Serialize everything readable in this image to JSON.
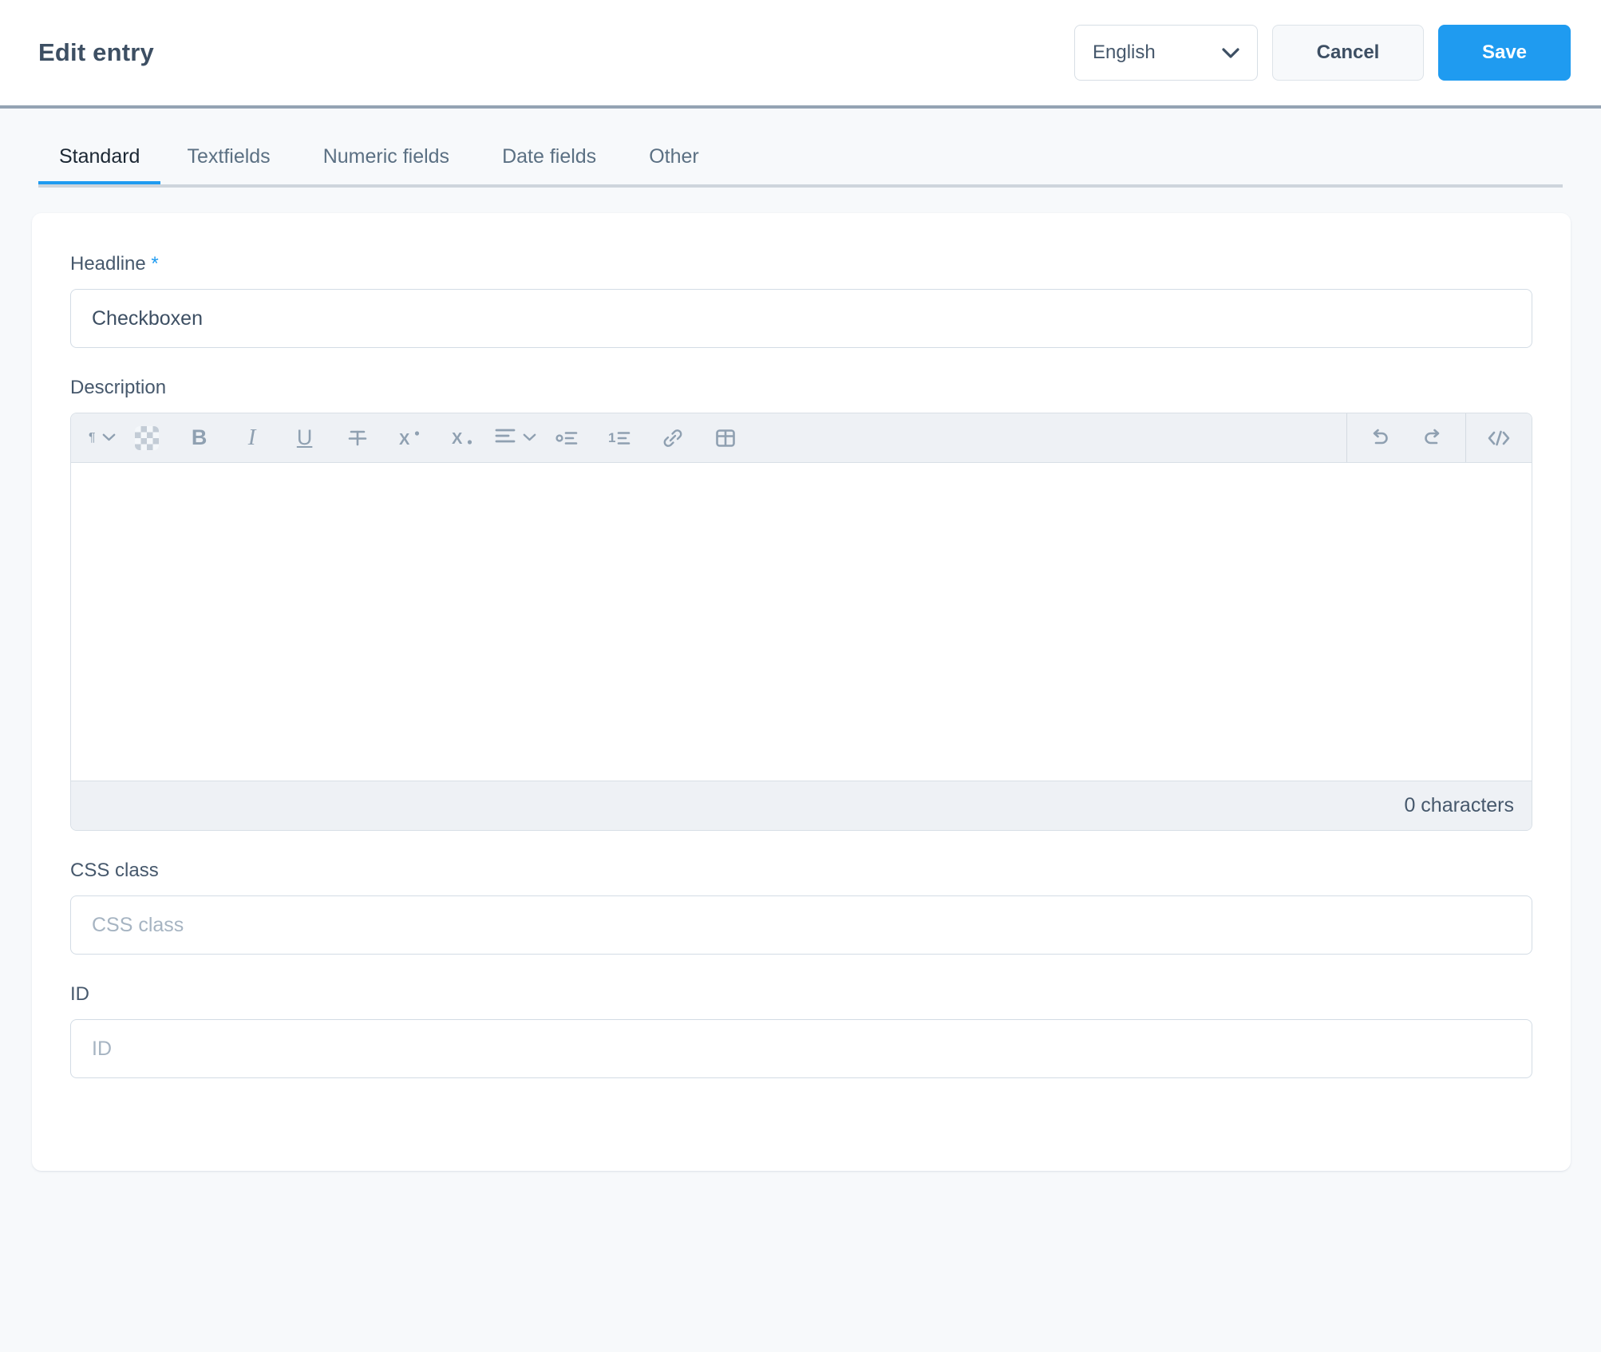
{
  "header": {
    "title": "Edit entry",
    "language_select": {
      "value": "English",
      "icon": "chevron-down-icon"
    },
    "cancel_label": "Cancel",
    "save_label": "Save"
  },
  "tabs": [
    {
      "label": "Standard",
      "active": true
    },
    {
      "label": "Textfields",
      "active": false
    },
    {
      "label": "Numeric fields",
      "active": false
    },
    {
      "label": "Date fields",
      "active": false
    },
    {
      "label": "Other",
      "active": false
    }
  ],
  "form": {
    "headline": {
      "label": "Headline",
      "required_marker": "*",
      "value": "Checkboxen",
      "placeholder": ""
    },
    "description": {
      "label": "Description",
      "value": "",
      "character_count": "0 characters",
      "toolbar": {
        "left": [
          {
            "name": "paragraph-format-dropdown",
            "glyph": "¶",
            "icon": "paragraph-icon"
          },
          {
            "name": "remove-format-button",
            "icon": "checkered-remove-format-icon"
          },
          {
            "name": "bold-button",
            "glyph": "B",
            "icon": "bold-icon"
          },
          {
            "name": "italic-button",
            "glyph": "I",
            "icon": "italic-icon"
          },
          {
            "name": "underline-button",
            "glyph": "U",
            "icon": "underline-icon"
          },
          {
            "name": "strikethrough-button",
            "glyph": "S",
            "icon": "strikethrough-icon"
          },
          {
            "name": "superscript-button",
            "glyph": "X",
            "icon": "superscript-icon"
          },
          {
            "name": "subscript-button",
            "glyph": "X",
            "icon": "subscript-icon"
          },
          {
            "name": "align-dropdown",
            "icon": "align-left-icon"
          },
          {
            "name": "bulleted-list-button",
            "icon": "bulleted-list-icon"
          },
          {
            "name": "numbered-list-button",
            "icon": "numbered-list-icon"
          },
          {
            "name": "link-button",
            "icon": "link-icon"
          },
          {
            "name": "insert-table-button",
            "icon": "table-icon"
          }
        ],
        "right": [
          {
            "name": "undo-button",
            "icon": "undo-icon"
          },
          {
            "name": "redo-button",
            "icon": "redo-icon"
          },
          {
            "name": "source-code-button",
            "icon": "source-code-icon"
          }
        ]
      }
    },
    "css_class": {
      "label": "CSS class",
      "value": "",
      "placeholder": "CSS class"
    },
    "id": {
      "label": "ID",
      "value": "",
      "placeholder": "ID"
    }
  },
  "colors": {
    "accent": "#1f9bf0",
    "text_dark": "#3d4f63",
    "text_muted": "#5b7083",
    "page_bg": "#f7f9fb",
    "toolbar_bg": "#eef1f5",
    "border": "#d8dfe6"
  }
}
